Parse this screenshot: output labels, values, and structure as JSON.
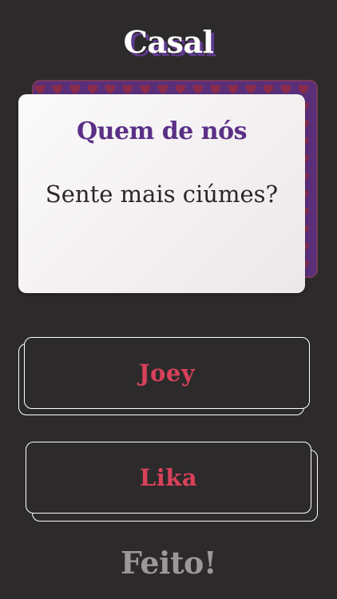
{
  "header": {
    "title": "Casal"
  },
  "card": {
    "heading": "Quem de nós",
    "question": "Sente mais ciúmes?"
  },
  "answers": [
    {
      "label": "Joey"
    },
    {
      "label": "Lika"
    }
  ],
  "footer": {
    "done_label": "Feito!"
  },
  "colors": {
    "background": "#2d2a2b",
    "accent_purple": "#5b2f86",
    "answer_red": "#d8415a",
    "heart_pattern": "#8a2c4a",
    "done_gray": "#9b9899"
  },
  "icons": {
    "card_back_pattern": "heart-icon"
  }
}
